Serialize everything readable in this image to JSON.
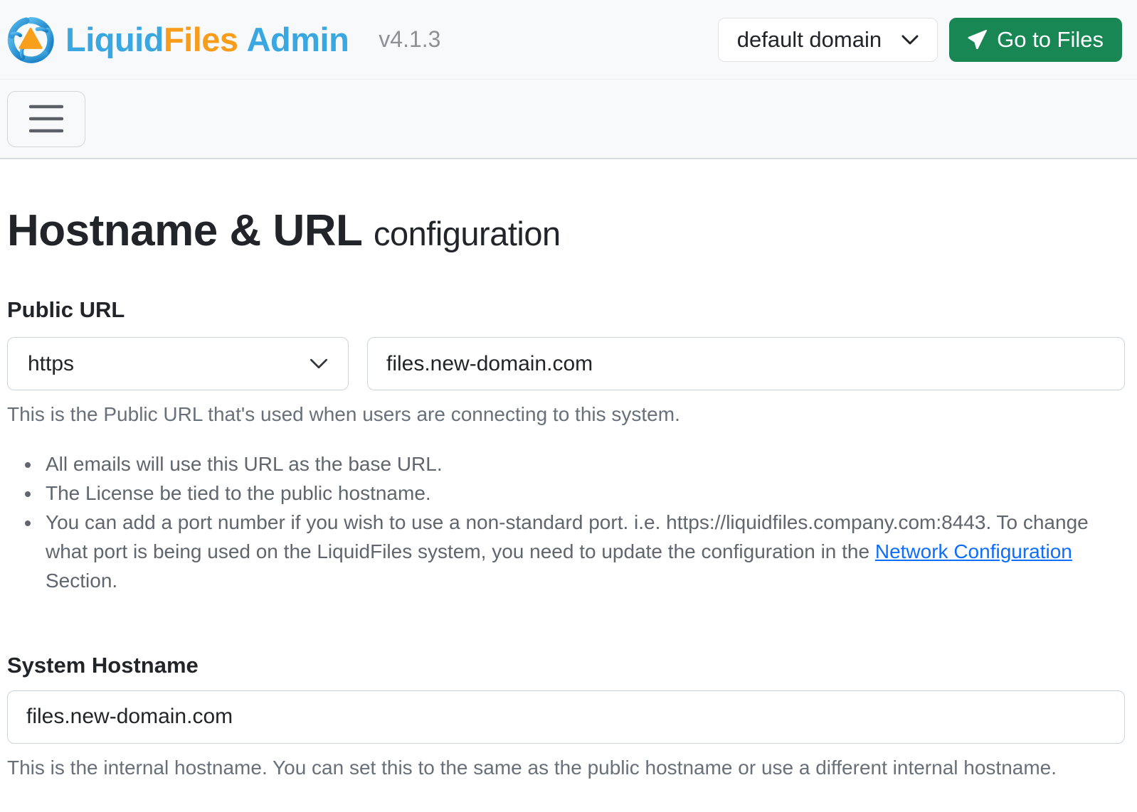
{
  "header": {
    "brand": {
      "liquid": "Liquid",
      "files": "Files",
      "admin": "Admin"
    },
    "version": "v4.1.3",
    "domain_selector": {
      "value": "default domain"
    },
    "go_to_files_label": "Go to Files"
  },
  "icons": {
    "logo": "liquidfiles-swirl",
    "chevron_down": "⌄",
    "send": "➤",
    "hamburger": "≡"
  },
  "colors": {
    "brand_blue": "#3aa7e0",
    "brand_orange": "#f89c1c",
    "button_green": "#198754",
    "link_blue": "#0d6efd",
    "toolbar_bg": "#f8f9fa"
  },
  "page": {
    "title_main": "Hostname & URL",
    "title_sub": "configuration"
  },
  "public_url": {
    "label": "Public URL",
    "scheme_selected": "https",
    "hostname_value": "files.new-domain.com",
    "help": "This is the Public URL that's used when users are connecting to this system.",
    "bullets": [
      {
        "before": "All emails will use this URL as the base URL.",
        "link": "",
        "after": ""
      },
      {
        "before": "The License be tied to the public hostname.",
        "link": "",
        "after": ""
      },
      {
        "before": "You can add a port number if you wish to use a non-standard port. i.e. https://liquidfiles.company.com:8443. To change what port is being used on the LiquidFiles system, you need to update the configuration in the ",
        "link": "Network Configuration",
        "after": " Section."
      }
    ]
  },
  "system_hostname": {
    "label": "System Hostname",
    "value": "files.new-domain.com",
    "help": "This is the internal hostname. You can set this to the same as the public hostname or use a different internal hostname."
  }
}
